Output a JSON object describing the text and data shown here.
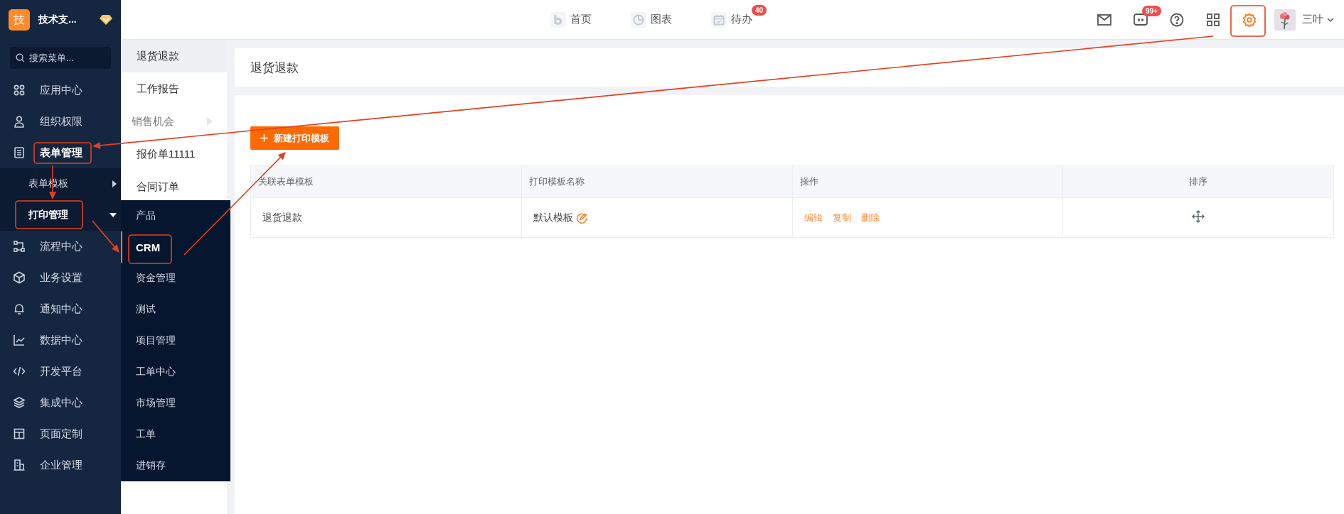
{
  "sidebar": {
    "logo": "技",
    "org": "技术支...",
    "search": {
      "placeholder": "搜索菜单..."
    },
    "items": [
      {
        "label": "应用中心",
        "expanded": false
      },
      {
        "label": "组织权限",
        "expanded": false
      },
      {
        "label": "表单管理",
        "expanded": true,
        "children": [
          {
            "label": "表单模板",
            "expanded": false
          },
          {
            "label": "打印管理",
            "expanded": true
          }
        ]
      },
      {
        "label": "流程中心",
        "expanded": false
      },
      {
        "label": "业务设置",
        "expanded": false
      },
      {
        "label": "通知中心",
        "expanded": false
      },
      {
        "label": "数据中心",
        "expanded": false
      },
      {
        "label": "开发平台",
        "expanded": false
      },
      {
        "label": "集成中心",
        "expanded": false
      },
      {
        "label": "页面定制",
        "expanded": false
      },
      {
        "label": "企业管理",
        "expanded": false
      }
    ]
  },
  "flyout": {
    "items": [
      {
        "label": "产品",
        "selected": false
      },
      {
        "label": "CRM",
        "selected": true
      },
      {
        "label": "资金管理",
        "selected": false
      },
      {
        "label": "测试",
        "selected": false
      },
      {
        "label": "项目管理",
        "selected": false
      },
      {
        "label": "工单中心",
        "selected": false
      },
      {
        "label": "市场管理",
        "selected": false
      },
      {
        "label": "工单",
        "selected": false
      },
      {
        "label": "进销存",
        "selected": false
      }
    ]
  },
  "topbar": {
    "nav": [
      {
        "label": "首页"
      },
      {
        "label": "图表"
      },
      {
        "label": "待办",
        "badge": "40"
      }
    ],
    "message_badge": "99+",
    "user": "三叶"
  },
  "forms": [
    {
      "label": "退货退款",
      "kind": "form",
      "selected": true
    },
    {
      "label": "工作报告",
      "kind": "form",
      "selected": false
    },
    {
      "label": "销售机会",
      "kind": "group",
      "selected": false
    },
    {
      "label": "报价单11111",
      "kind": "form",
      "selected": false
    },
    {
      "label": "合同订单",
      "kind": "form",
      "selected": false
    }
  ],
  "page": {
    "title": "退货退款",
    "new_button": "新建打印模板",
    "table": {
      "columns": [
        "关联表单模板",
        "打印模板名称",
        "操作",
        "排序"
      ],
      "rows": [
        {
          "form": "退货退款",
          "template": "默认模板",
          "actions": [
            "编辑",
            "复制",
            "删除"
          ]
        }
      ]
    }
  },
  "annotations": [
    {
      "kind": "frame"
    },
    {
      "kind": "arrow"
    },
    {
      "kind": "frame"
    },
    {
      "kind": "arrow"
    },
    {
      "kind": "frame"
    },
    {
      "kind": "arrow"
    },
    {
      "kind": "frame"
    },
    {
      "kind": "arrow"
    }
  ]
}
